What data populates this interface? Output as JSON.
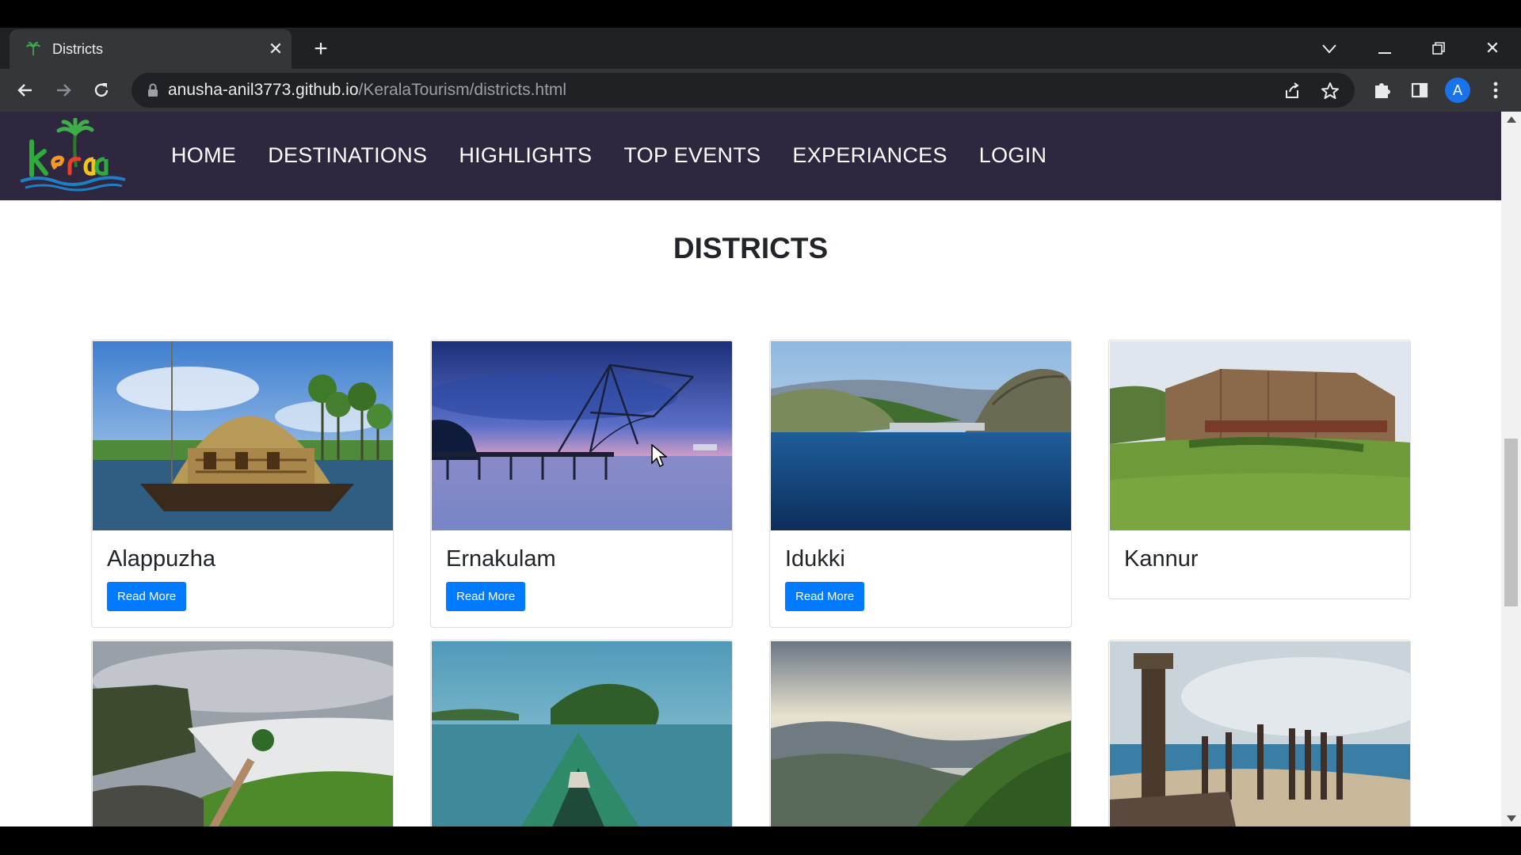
{
  "browser": {
    "tab_title": "Districts",
    "url_host": "anusha-anil3773.github.io",
    "url_path": "/KeralaTourism/districts.html",
    "profile_initial": "A"
  },
  "site": {
    "logo_alt": "kerala",
    "nav": [
      "HOME",
      "DESTINATIONS",
      "HIGHLIGHTS",
      "TOP EVENTS",
      "EXPERIANCES",
      "LOGIN"
    ],
    "nav_bg": "#2f2640"
  },
  "page": {
    "heading": "DISTRICTS"
  },
  "districts": [
    {
      "name": "Alappuzha",
      "button": "Read More",
      "scene": "houseboat"
    },
    {
      "name": "Ernakulam",
      "button": "Read More",
      "scene": "fishing-net"
    },
    {
      "name": "Idukki",
      "button": "Read More",
      "scene": "dam-lake"
    },
    {
      "name": "Kannur",
      "scene": "fort"
    },
    {
      "scene": "coastal-fort"
    },
    {
      "scene": "boat-backwater"
    },
    {
      "scene": "mountain-valley"
    },
    {
      "scene": "beach-ruins"
    }
  ],
  "colors": {
    "button": "#007bff",
    "accent_green": "#2eab3b",
    "accent_blue": "#1f7ec4"
  }
}
